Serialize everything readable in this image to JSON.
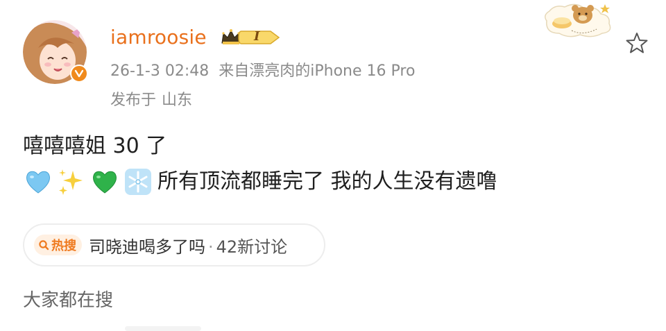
{
  "user": {
    "name": "iamroosie",
    "level_label": "I"
  },
  "post": {
    "time": "26-1-3 02:48",
    "source": "来自漂亮肉的iPhone 16 Pro",
    "location_prefix": "发布于",
    "location": "山东",
    "line1": "嘻嘻嘻姐 30 了",
    "emojis": [
      "blue-heart",
      "sparkles",
      "green-heart",
      "snowflake"
    ],
    "line2": "所有顶流都睡完了 我的人生没有遗噜"
  },
  "hot_search": {
    "tag": "热搜",
    "topic": "司晓迪喝多了吗",
    "separator": "·",
    "count": "42新讨论"
  },
  "section": {
    "title": "大家都在搜"
  },
  "colors": {
    "username": "#e9701c",
    "meta": "#8a8a8a",
    "hot_tag": "#ef7a1f",
    "badge": "#f08a1c"
  }
}
